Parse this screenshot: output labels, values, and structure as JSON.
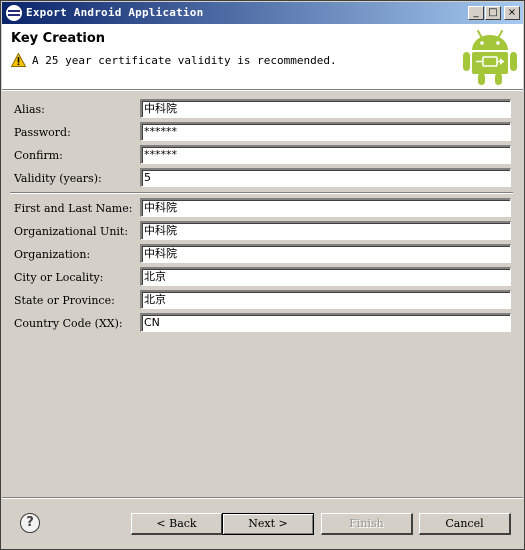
{
  "window": {
    "title": "Export Android Application",
    "controls": {
      "minimize": "_",
      "maximize": "□",
      "close": "×"
    }
  },
  "header": {
    "title": "Key Creation",
    "message": "A 25 year certificate validity is recommended.",
    "warning_icon": "warning-icon",
    "logo_icon": "android-logo"
  },
  "form": {
    "alias": {
      "label": "Alias:",
      "value": "中科院"
    },
    "password": {
      "label": "Password:",
      "value": "******"
    },
    "confirm": {
      "label": "Confirm:",
      "value": "******"
    },
    "validity": {
      "label": "Validity (years):",
      "value": "5"
    },
    "first_last_name": {
      "label": "First and Last Name:",
      "value": "中科院"
    },
    "org_unit": {
      "label": "Organizational Unit:",
      "value": "中科院"
    },
    "organization": {
      "label": "Organization:",
      "value": "中科院"
    },
    "city": {
      "label": "City or Locality:",
      "value": "北京"
    },
    "state": {
      "label": "State or Province:",
      "value": "北京"
    },
    "country": {
      "label": "Country Code (XX):",
      "value": "CN"
    }
  },
  "footer": {
    "help": "?",
    "back": "< Back",
    "next": "Next >",
    "finish": "Finish",
    "cancel": "Cancel"
  },
  "colors": {
    "titlebar_start": "#0a246a",
    "titlebar_end": "#a6caf0",
    "android_green": "#a4c639",
    "dialog_bg": "#d4d0c8"
  }
}
